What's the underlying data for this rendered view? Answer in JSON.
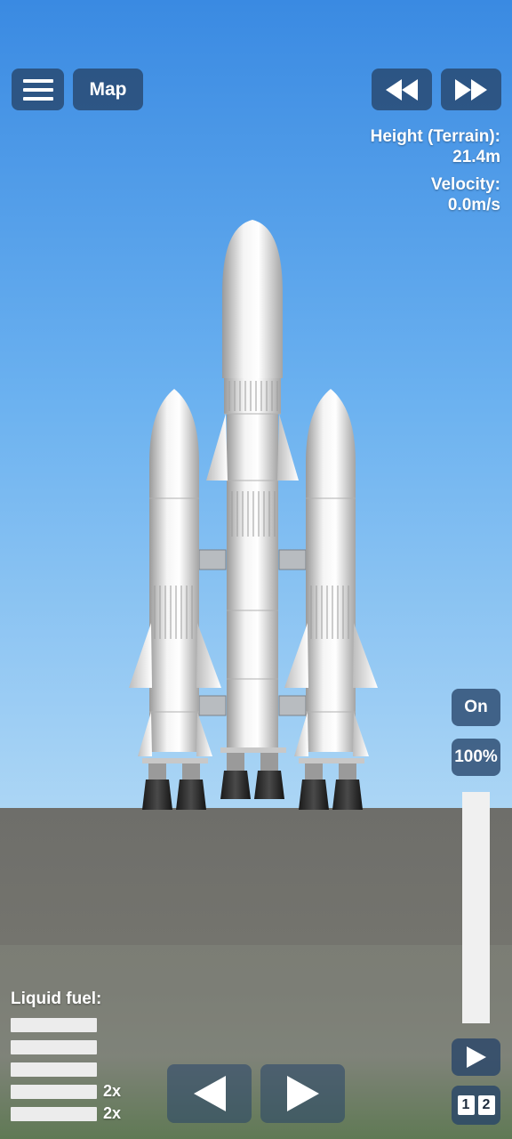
{
  "top_left": {
    "menu_icon": "hamburger-icon",
    "map_label": "Map"
  },
  "time_controls": {
    "rewind_icon": "rewind-icon",
    "fast_forward_icon": "fast-forward-icon"
  },
  "telemetry": {
    "height_label": "Height (Terrain):",
    "height_value": "21.4m",
    "velocity_label": "Velocity:",
    "velocity_value": "0.0m/s"
  },
  "right_panel": {
    "toggle_label": "On",
    "throttle_label": "100%",
    "throttle_level": 1.0,
    "play_icon": "play-icon",
    "stage_numbers": [
      "1",
      "2"
    ]
  },
  "fuel": {
    "label": "Liquid fuel:",
    "bars": [
      {
        "level": 1.0,
        "multiplier": ""
      },
      {
        "level": 1.0,
        "multiplier": ""
      },
      {
        "level": 1.0,
        "multiplier": ""
      },
      {
        "level": 1.0,
        "multiplier": "2x"
      },
      {
        "level": 1.0,
        "multiplier": "2x"
      }
    ]
  },
  "rotation_controls": {
    "left_icon": "rotate-left-icon",
    "right_icon": "rotate-right-icon"
  },
  "colors": {
    "sky_top": "#3f8ee4",
    "sky_bottom": "#a6d3f4",
    "ground": "#6f6f6b",
    "button_bg": "#264469",
    "rocket_body": "#e4e4e4"
  }
}
